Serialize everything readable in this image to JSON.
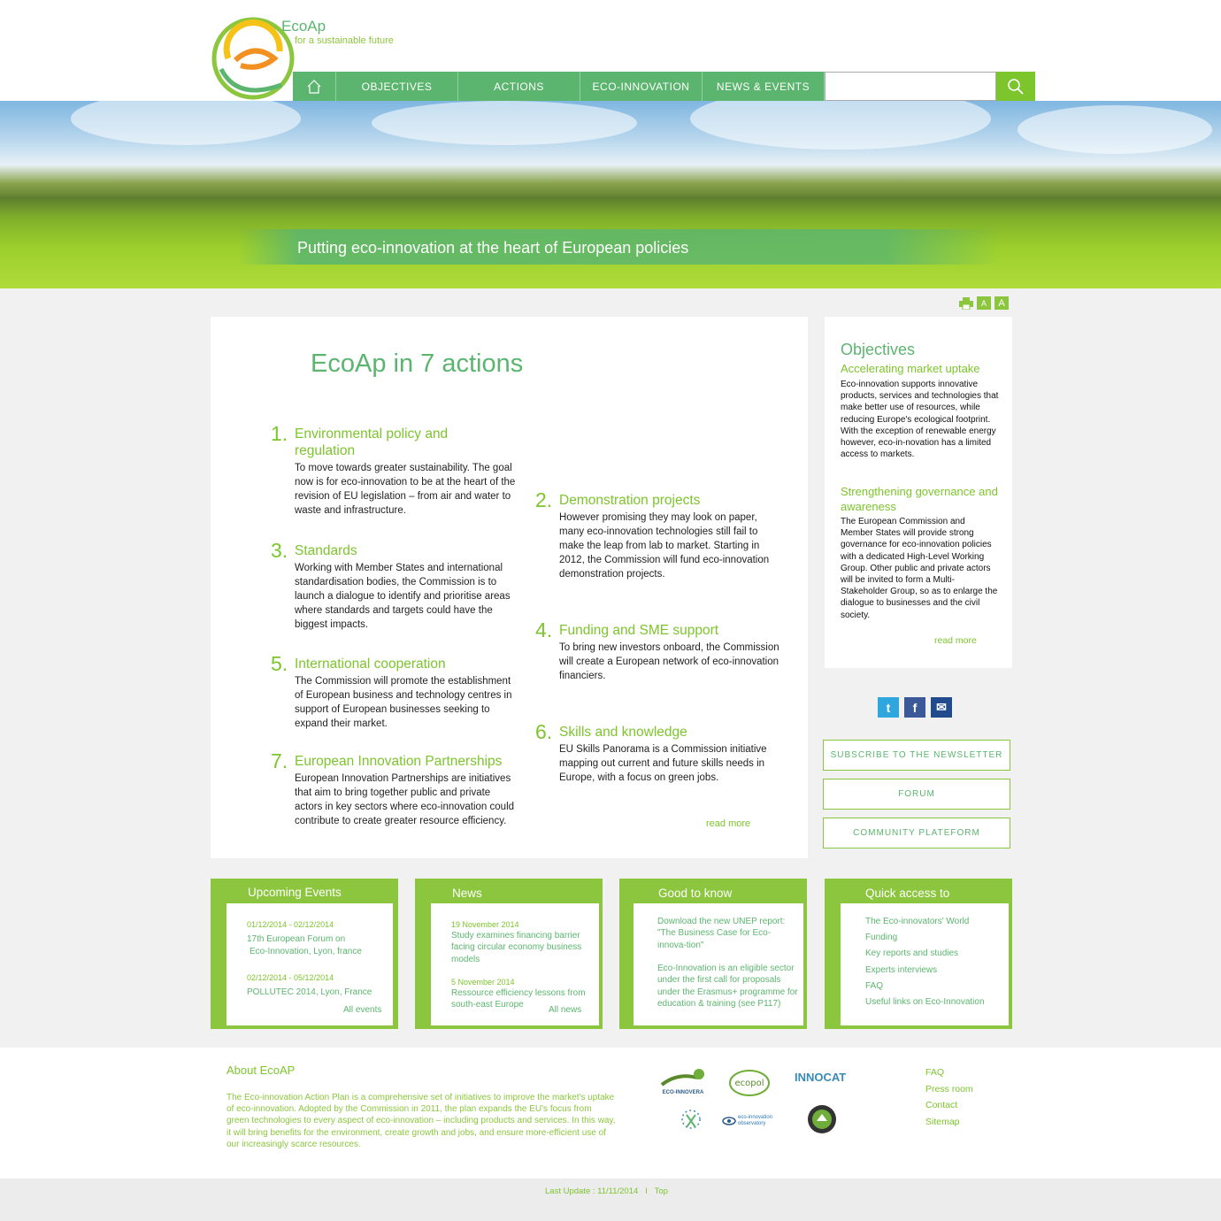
{
  "header": {
    "brand": "EcoAp",
    "tagline": "for a sustainable future",
    "nav": [
      "OBJECTIVES",
      "ACTIONS",
      "ECO-INNOVATION",
      "NEWS & EVENTS"
    ],
    "search": {
      "value": "",
      "placeholder": ""
    }
  },
  "hero": {
    "caption": "Putting eco-innovation at the heart of European policies"
  },
  "tools": {
    "small_a": "A",
    "big_a": "A"
  },
  "main": {
    "title": "EcoAp in 7 actions",
    "actions": [
      {
        "num": "1.",
        "head": "Environmental policy and regulation",
        "body": "To move towards greater sustainability. The goal now is for eco-innovation to be at the heart of the revision of EU legislation – from air and water to waste and infrastructure."
      },
      {
        "num": "2.",
        "head": "Demonstration projects",
        "body": "However promising they may look on paper, many eco-innovation technologies still fail to make the leap from lab to market. Starting in 2012, the Commission will fund eco-innovation demonstration projects."
      },
      {
        "num": "3.",
        "head": "Standards",
        "body": "Working with Member States and international standardisation bodies, the Commission is to launch a dialogue to identify and prioritise areas where standards and targets could have the biggest impacts."
      },
      {
        "num": "4.",
        "head": "Funding and SME support",
        "body": "To bring new investors onboard, the Commission will create a European network of eco-innovation financiers."
      },
      {
        "num": "5.",
        "head": "International cooperation",
        "body": "The Commission will promote the establishment of European business and technology centres in support of European businesses seeking to expand their market."
      },
      {
        "num": "6.",
        "head": "Skills and knowledge",
        "body": "EU Skills Panorama is a Commission initiative mapping out current and future skills needs in Europe, with a focus on green jobs."
      },
      {
        "num": "7.",
        "head": "European Innovation Partnerships",
        "body": "European Innovation Partnerships are initiatives that aim to bring together public and private actors in key sectors where eco-innovation could contribute to create greater resource efficiency."
      }
    ],
    "read_more": "read more"
  },
  "objectives": {
    "title": "Objectives",
    "sub1": "Accelerating market uptake",
    "body1": "Eco-innovation supports innovative products, services and technologies that make better use of resources, while reducing Europe's ecological footprint. With the exception of renewable energy however, eco-in-novation has a limited access to markets.",
    "sub2": "Strengthening governance and awareness",
    "body2": "The European Commission and Member States will provide strong governance for eco-innovation policies with a dedicated High-Level Working Group. Other public and private actors will be invited to form a Multi-Stakeholder Group, so as to enlarge the dialogue to businesses and the civil society.",
    "read_more": "read more"
  },
  "social": {
    "twitter": "t",
    "facebook": "f",
    "email": "✉"
  },
  "side_buttons": [
    "SUBSCRIBE TO THE NEWSLETTER",
    "FORUM",
    "COMMUNITY PLATEFORM"
  ],
  "boxes": {
    "events": {
      "title": "Upcoming Events",
      "e1_date": "01/12/2014 - 02/12/2014",
      "e1_l1": "17th European Forum on",
      "e1_l2": "Eco-Innovation, Lyon, france",
      "e2_date": "02/12/2014 - 05/12/2014",
      "e2_text": "POLLUTEC 2014, Lyon, France",
      "more": "All events"
    },
    "news": {
      "title": "News",
      "n1_date": "19 November 2014",
      "n1_text": "Study examines financing barrier facing circular economy business models",
      "n2_date": "5 November 2014",
      "n2_text": "Ressource efficiency lessons from south-east Europe",
      "more": "All news"
    },
    "good": {
      "title": "Good to know",
      "g1": "Download the new UNEP report: \"The Business Case for Eco-innova-tion\"",
      "g2": "Eco-Innovation is an eligible sector under the first call for proposals under the Erasmus+ programme for education & training (see P117)"
    },
    "quick": {
      "title": "Quick access to",
      "links": [
        "The Eco-innovators' World",
        "Funding",
        "Key reports and studies",
        "Experts interviews",
        "FAQ",
        "Useful links on Eco-Innovation"
      ]
    }
  },
  "footer": {
    "about_title": "About EcoAP",
    "about_text": "The Eco-innovation Action Plan is a comprehensive set of initiatives to improve the market's uptake of eco-innovation. Adopted by the Commission in 2011, the plan expands the EU's focus from green technologies to every aspect of eco-innovation – including products and services. In this way, it will bring benefits for the environment, create growth and jobs, and ensure more-efficient use of our increasingly scarce resources.",
    "partners": {
      "ecoinnovera": "ECO-INNOVERA",
      "ecopol": "ecopol",
      "innocat": "INNOCAT",
      "observatory": "eco-innovation observatory"
    },
    "links": [
      "FAQ",
      "Press room",
      "Contact",
      "Sitemap"
    ],
    "last_update": "Last Update : 11/11/2014",
    "separator": "I",
    "top": "Top"
  },
  "colors": {
    "primary": "#5bb56f",
    "accent": "#7dc52d",
    "box": "#8cc63e"
  }
}
